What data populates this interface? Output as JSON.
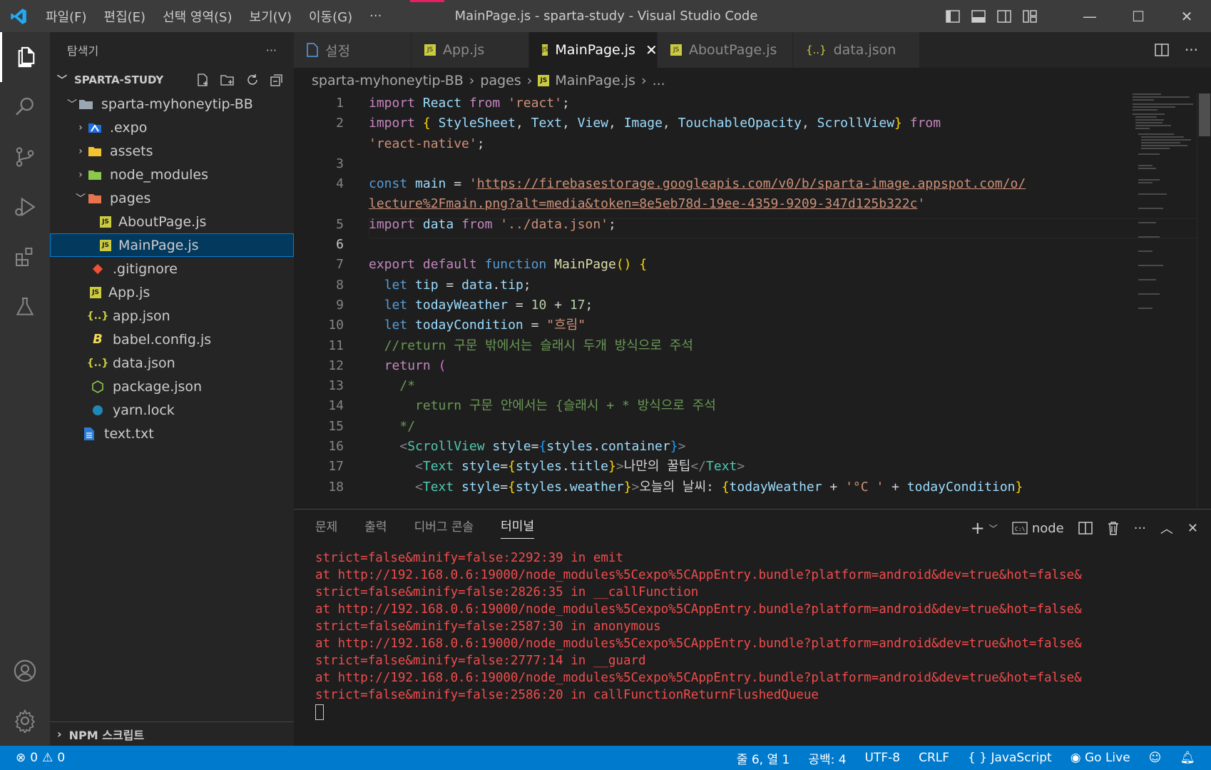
{
  "titlebar": {
    "menus": [
      "파일(F)",
      "편집(E)",
      "선택 영역(S)",
      "보기(V)",
      "이동(G)",
      "···"
    ],
    "title": "MainPage.js - sparta-study - Visual Studio Code"
  },
  "sidebar": {
    "header": "탐색기",
    "more": "···",
    "root": "SPARTA-STUDY",
    "folder": "sparta-myhoneytip-BB",
    "items": [
      {
        "label": ".expo",
        "type": "folder-expo"
      },
      {
        "label": "assets",
        "type": "folder-assets"
      },
      {
        "label": "node_modules",
        "type": "folder-node"
      },
      {
        "label": "pages",
        "type": "folder-pages"
      },
      {
        "label": "AboutPage.js",
        "type": "js"
      },
      {
        "label": "MainPage.js",
        "type": "js"
      },
      {
        "label": ".gitignore",
        "type": "git"
      },
      {
        "label": "App.js",
        "type": "js"
      },
      {
        "label": "app.json",
        "type": "json"
      },
      {
        "label": "babel.config.js",
        "type": "babel"
      },
      {
        "label": "data.json",
        "type": "json"
      },
      {
        "label": "package.json",
        "type": "node"
      },
      {
        "label": "yarn.lock",
        "type": "yarn"
      },
      {
        "label": "text.txt",
        "type": "txt"
      }
    ],
    "npm": "NPM 스크립트"
  },
  "tabs": [
    {
      "label": "설정",
      "icon": "file-icon"
    },
    {
      "label": "App.js",
      "icon": "js-icon"
    },
    {
      "label": "MainPage.js",
      "icon": "js-icon"
    },
    {
      "label": "AboutPage.js",
      "icon": "js-icon"
    },
    {
      "label": "data.json",
      "icon": "json-icon"
    }
  ],
  "breadcrumb": [
    "sparta-myhoneytip-BB",
    "pages",
    "MainPage.js",
    "..."
  ],
  "line_numbers": [
    "1",
    "2",
    "",
    "3",
    "4",
    "",
    "5",
    "6",
    "7",
    "8",
    "9",
    "10",
    "11",
    "12",
    "13",
    "14",
    "15",
    "16",
    "17",
    "18"
  ],
  "panel": {
    "tabs": [
      "문제",
      "출력",
      "디버그 콘솔",
      "터미널"
    ],
    "terminal_name": "node",
    "lines": [
      "strict=false&minify=false:2292:39 in emit",
      "at http://192.168.0.6:19000/node_modules%5Cexpo%5CAppEntry.bundle?platform=android&dev=true&hot=false&",
      "strict=false&minify=false:2826:35 in __callFunction",
      "at http://192.168.0.6:19000/node_modules%5Cexpo%5CAppEntry.bundle?platform=android&dev=true&hot=false&",
      "strict=false&minify=false:2587:30 in anonymous",
      "at http://192.168.0.6:19000/node_modules%5Cexpo%5CAppEntry.bundle?platform=android&dev=true&hot=false&",
      "strict=false&minify=false:2777:14 in __guard",
      "at http://192.168.0.6:19000/node_modules%5Cexpo%5CAppEntry.bundle?platform=android&dev=true&hot=false&",
      "strict=false&minify=false:2586:20 in callFunctionReturnFlushedQueue"
    ]
  },
  "status": {
    "errors": "0",
    "warnings": "0",
    "position": "줄 6, 열 1",
    "spaces": "공백: 4",
    "encoding": "UTF-8",
    "eol": "CRLF",
    "language": "JavaScript",
    "golive": "Go Live"
  },
  "colors": {
    "accent": "#007acc",
    "activity": "#333333",
    "sidebar": "#252526",
    "editor": "#1e1e1e"
  }
}
